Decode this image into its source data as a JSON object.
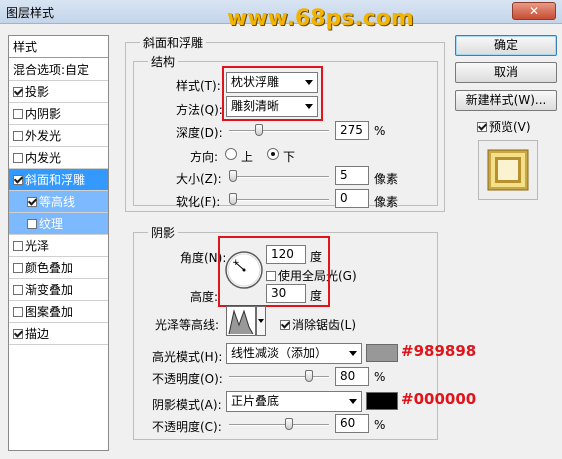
{
  "window": {
    "title": "图层样式",
    "close_glyph": "✕"
  },
  "watermark": "www.68ps.com",
  "left_panel": {
    "header": "样式",
    "blend_options": "混合选项:自定",
    "items": [
      {
        "label": "投影",
        "checked": true
      },
      {
        "label": "内阴影",
        "checked": false
      },
      {
        "label": "外发光",
        "checked": false
      },
      {
        "label": "内发光",
        "checked": false
      },
      {
        "label": "斜面和浮雕",
        "checked": true,
        "selected": true
      },
      {
        "label": "等高线",
        "checked": true,
        "sub": true
      },
      {
        "label": "纹理",
        "checked": false,
        "sub": true
      },
      {
        "label": "光泽",
        "checked": false
      },
      {
        "label": "颜色叠加",
        "checked": false
      },
      {
        "label": "渐变叠加",
        "checked": false
      },
      {
        "label": "图案叠加",
        "checked": false
      },
      {
        "label": "描边",
        "checked": true
      }
    ]
  },
  "bevel": {
    "section_title": "斜面和浮雕",
    "structure_title": "结构",
    "style_label": "样式(T):",
    "style_value": "枕状浮雕",
    "technique_label": "方法(Q):",
    "technique_value": "雕刻清晰",
    "depth_label": "深度(D):",
    "depth_value": "275",
    "depth_unit": "%",
    "direction_label": "方向:",
    "direction_up": "上",
    "direction_down": "下",
    "size_label": "大小(Z):",
    "size_value": "5",
    "size_unit": "像素",
    "soften_label": "软化(F):",
    "soften_value": "0",
    "soften_unit": "像素"
  },
  "shading": {
    "title": "阴影",
    "angle_label": "角度(N):",
    "angle_value": "120",
    "angle_unit": "度",
    "global_light_label": "使用全局光(G)",
    "altitude_label": "高度:",
    "altitude_value": "30",
    "altitude_unit": "度",
    "gloss_contour_label": "光泽等高线:",
    "antialias_label": "消除锯齿(L)",
    "highlight_mode_label": "高光模式(H):",
    "highlight_mode_value": "线性减淡（添加）",
    "highlight_color": "#989898",
    "highlight_opacity_label": "不透明度(O):",
    "highlight_opacity_value": "80",
    "shadow_mode_label": "阴影模式(A):",
    "shadow_mode_value": "正片叠底",
    "shadow_color": "#000000",
    "shadow_opacity_label": "不透明度(C):",
    "shadow_opacity_value": "60",
    "percent": "%"
  },
  "annotations": {
    "highlight": "#989898",
    "shadow": "#000000"
  },
  "buttons": {
    "ok": "确定",
    "cancel": "取消",
    "new_style": "新建样式(W)...",
    "preview": "预览(V)"
  }
}
